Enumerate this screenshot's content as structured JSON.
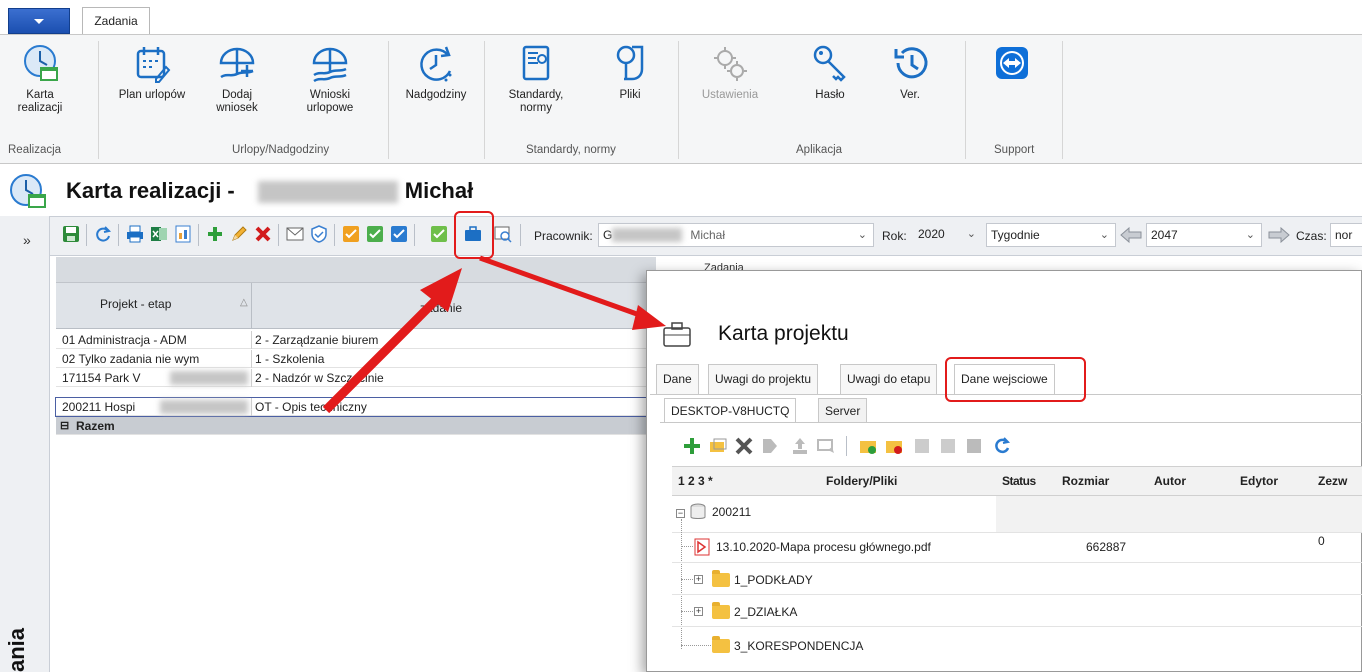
{
  "ribbon": {
    "tab": "Zadania",
    "buttons": {
      "karta": "Karta realizacji",
      "plan": "Plan urlopów",
      "dodaj": "Dodaj wniosek",
      "wnioski": "Wnioski urlopowe",
      "nadgodziny": "Nadgodziny",
      "standardy": "Standardy, normy",
      "pliki": "Pliki",
      "ustawienia": "Ustawienia",
      "haslo": "Hasło",
      "ver": "Ver."
    },
    "groups": {
      "realizacja": "Realizacja",
      "urlopy": "Urlopy/Nadgodziny",
      "standardy": "Standardy, normy",
      "aplikacja": "Aplikacja",
      "support": "Support"
    }
  },
  "page": {
    "title_prefix": "Karta realizacji -",
    "title_name": "Michał",
    "nav_collapse": "»",
    "nav_vertical": "ania"
  },
  "toolbar": {
    "pracownik_label": "Pracownik:",
    "pracownik_prefix": "G",
    "pracownik_name": "Michał",
    "rok_label": "Rok:",
    "rok_value": "2020",
    "period_value": "Tygodnie",
    "week_value": "2047",
    "czas_label": "Czas:",
    "czas_value": "nor"
  },
  "grid": {
    "group_header": "Zadania",
    "col_projekt": "Projekt - etap",
    "col_zadanie": "zadanie",
    "rows": [
      {
        "projekt": "01  Administracja  -  ADM",
        "zadanie": "2 - Zarządzanie biurem"
      },
      {
        "projekt": "02  Tylko zadania nie wym",
        "zadanie": "1 - Szkolenia"
      },
      {
        "projekt": "171154  Park V",
        "zadanie": "2 - Nadzór w Szczecinie"
      },
      {
        "projekt": "200211  Hospi",
        "zadanie": "OT - Opis techniczny"
      }
    ],
    "summary": "Razem"
  },
  "dialog": {
    "title": "Karta projektu",
    "tabs": [
      "Dane",
      "Uwagi do projektu",
      "Uwagi  do etapu",
      "Dane wejsciowe"
    ],
    "subtabs": [
      "DESKTOP-V8HUCTQ",
      "Server"
    ],
    "columns": {
      "nums": "1 2 3 *",
      "name": "Foldery/Pliki",
      "status": "Status",
      "size": "Rozmiar",
      "author": "Autor",
      "editor": "Edytor",
      "perm": "Zezw"
    },
    "tree": {
      "root": "200211",
      "file": {
        "name": "13.10.2020-Mapa procesu głównego.pdf",
        "size": "662887",
        "perm": "0"
      },
      "folders": [
        "1_PODKŁADY",
        "2_DZIAŁKA",
        "3_KORESPONDENCJA"
      ]
    }
  },
  "colors": {
    "accent": "#1c6fc4",
    "annotation": "#e21b1b"
  }
}
